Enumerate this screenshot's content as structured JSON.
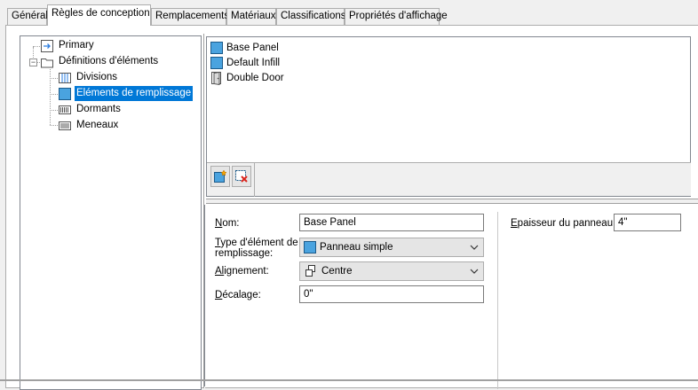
{
  "tabs": [
    {
      "label": "Général",
      "active": false
    },
    {
      "label": "Règles de conception",
      "active": true
    },
    {
      "label": "Remplacements",
      "active": false
    },
    {
      "label": "Matériaux",
      "active": false
    },
    {
      "label": "Classifications",
      "active": false
    },
    {
      "label": "Propriétés d'affichage",
      "active": false
    }
  ],
  "tree": {
    "primary": "Primary",
    "definitions": "Définitions d'éléments",
    "children": [
      "Divisions",
      "Eléments de remplissage",
      "Dormants",
      "Meneaux"
    ],
    "selected_child": "Eléments de remplissage"
  },
  "list": {
    "items": [
      {
        "label": "Base Panel",
        "icon": "panel-icon"
      },
      {
        "label": "Default Infill",
        "icon": "panel-icon"
      },
      {
        "label": "Double Door",
        "icon": "door-icon"
      }
    ],
    "toolbar": {
      "add_icon": "new-infill-icon",
      "remove_icon": "delete-infill-icon"
    }
  },
  "properties": {
    "name_label_u": "N",
    "name_label_rest": "om:",
    "name_value": "Base Panel",
    "type_label_u": "T",
    "type_label_rest1": "ype d'élément de",
    "type_label_rest2": "remplissage:",
    "type_value": "Panneau simple",
    "align_label_u1": "Al",
    "align_label_u2": "i",
    "align_label_rest": "gnement:",
    "align_value": "Centre",
    "offset_label_u": "D",
    "offset_label_rest": "écalage:",
    "offset_value": "0\"",
    "thickness_label_u": "E",
    "thickness_label_rest": "paisseur du panneau:",
    "thickness_value": "4\""
  },
  "colors": {
    "selection": "#0078d7",
    "panel_blue": "#4aa3df"
  }
}
